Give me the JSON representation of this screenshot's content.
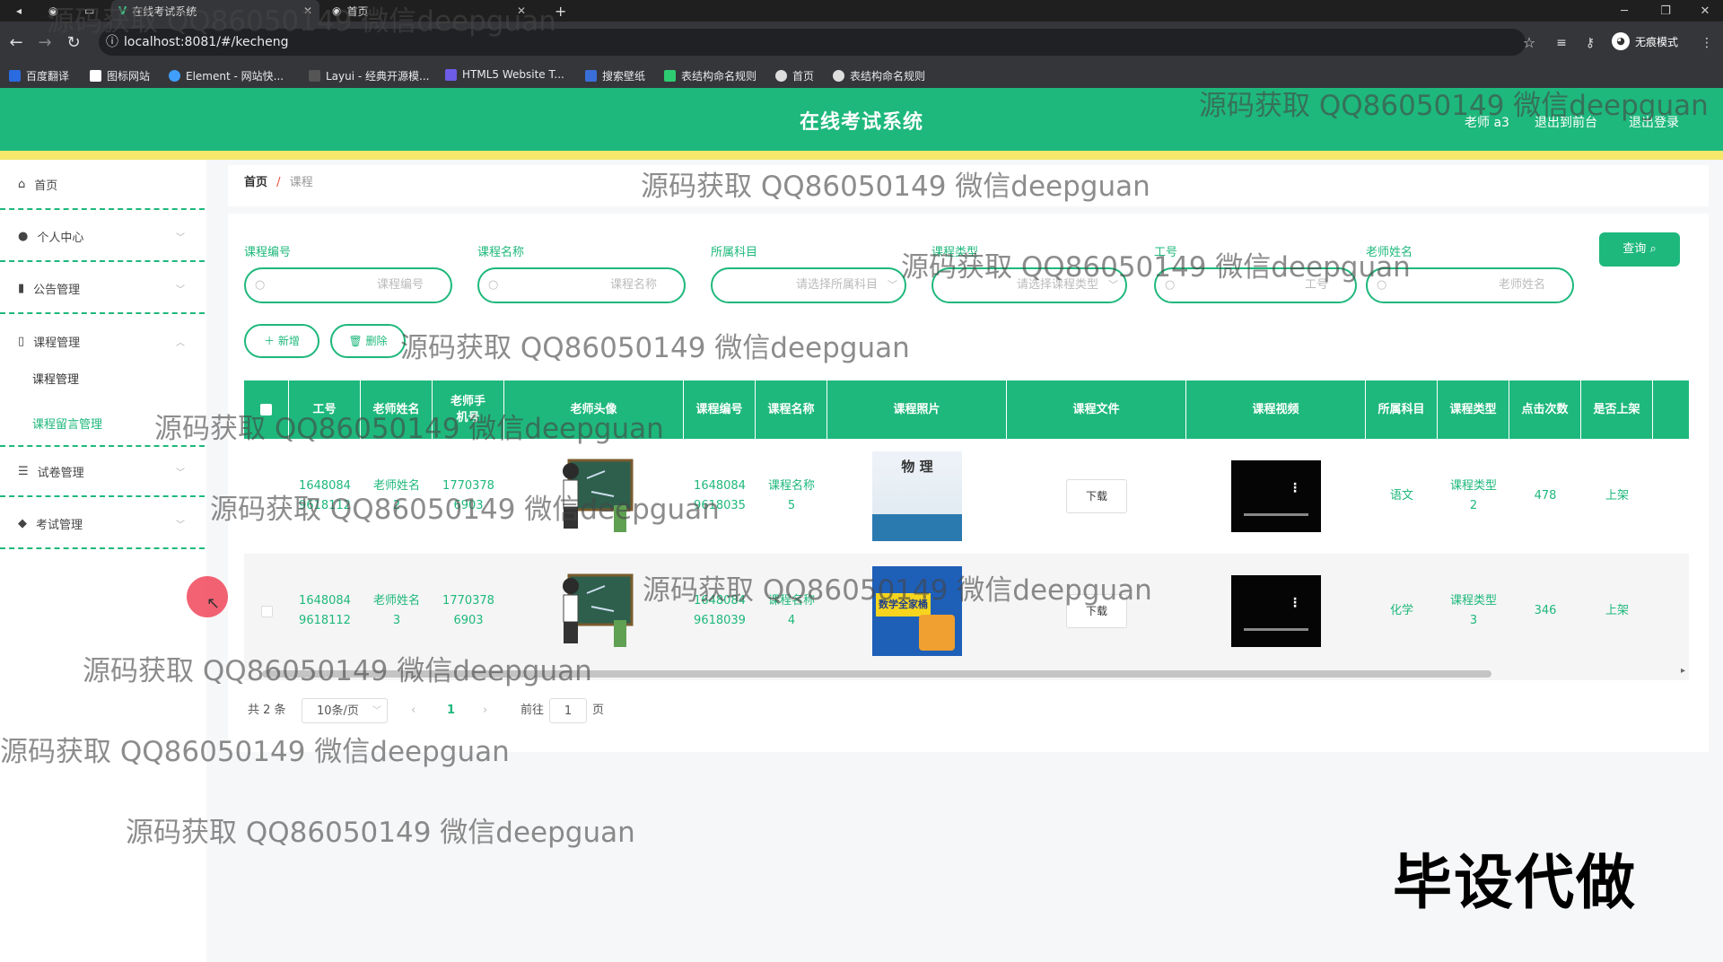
{
  "browser": {
    "tabs": [
      {
        "label": "在线考试系统",
        "active": true
      },
      {
        "label": "首页",
        "active": false
      }
    ],
    "url": "localhost:8081/#/kecheng",
    "profile": "无痕模式",
    "bookmarks": [
      "百度翻译",
      "图标网站",
      "Element - 网站快...",
      "Layui - 经典开源模...",
      "HTML5 Website T...",
      "搜索壁纸",
      "表结构命名规则",
      "首页",
      "表结构命名规则"
    ]
  },
  "header": {
    "title": "在线考试系统",
    "user": "老师 a3",
    "to_front": "退出到前台",
    "logout": "退出登录"
  },
  "sidebar": {
    "items": [
      {
        "label": "首页"
      },
      {
        "label": "个人中心"
      },
      {
        "label": "公告管理"
      },
      {
        "label": "课程管理"
      },
      {
        "label": "试卷管理"
      },
      {
        "label": "考试管理"
      }
    ],
    "sub_items": [
      "课程管理",
      "课程留言管理"
    ]
  },
  "breadcrumb": {
    "home": "首页",
    "sep": "/",
    "current": "课程"
  },
  "filters": [
    {
      "label": "课程编号",
      "placeholder": "课程编号"
    },
    {
      "label": "课程名称",
      "placeholder": "课程名称"
    },
    {
      "label": "所属科目",
      "placeholder": "请选择所属科目"
    },
    {
      "label": "课程类型",
      "placeholder": "请选择课程类型"
    },
    {
      "label": "工号",
      "placeholder": "工号"
    },
    {
      "label": "老师姓名",
      "placeholder": "老师姓名"
    }
  ],
  "actions": {
    "search": "查询",
    "add": "新增",
    "delete": "删除"
  },
  "table": {
    "headers": [
      "工号",
      "老师姓名",
      "老师手机号",
      "老师头像",
      "课程编号",
      "课程名称",
      "课程照片",
      "课程文件",
      "课程视频",
      "所属科目",
      "课程类型",
      "点击次数",
      "是否上架"
    ],
    "rows": [
      {
        "gonghao": "1648084 9618112",
        "name": "老师姓名 2",
        "phone": "1770378 6903",
        "code": "1648084 9618035",
        "kname": "课程名称 5",
        "file": "下载",
        "subject": "语文",
        "type": "课程类型 2",
        "clicks": "478",
        "status": "上架",
        "photo_text": "物 理"
      },
      {
        "gonghao": "1648084 9618112",
        "name": "老师姓名 3",
        "phone": "1770378 6903",
        "code": "1648084 9618039",
        "kname": "课程名称 4",
        "file": "下载",
        "subject": "化学",
        "type": "课程类型 3",
        "clicks": "346",
        "status": "上架",
        "photo_text": "数学全家桶"
      }
    ]
  },
  "pagination": {
    "total": "共 2 条",
    "size": "10条/页",
    "current": "1",
    "goto": "前往",
    "goto_value": "1",
    "page_unit": "页"
  },
  "watermark": "源码获取 QQ86050149 微信deepguan",
  "stamp": "毕设代做",
  "colors": {
    "primary": "#1eb87c",
    "accent": "#f5e86b"
  }
}
